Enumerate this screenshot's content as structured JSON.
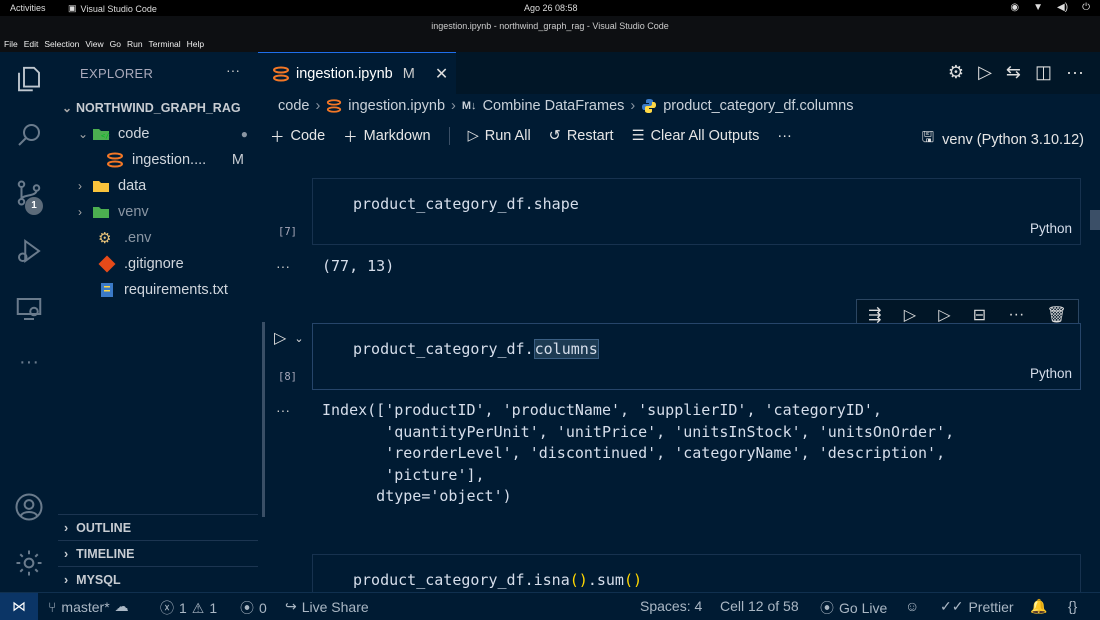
{
  "gnome": {
    "activities": "Activities",
    "app": "Visual Studio Code",
    "clock": "Ago 26  08:58"
  },
  "window": {
    "title": "ingestion.ipynb - northwind_graph_rag - Visual Studio Code"
  },
  "menu": [
    "File",
    "Edit",
    "Selection",
    "View",
    "Go",
    "Run",
    "Terminal",
    "Help"
  ],
  "activity_bar": {
    "icons": [
      "files-icon",
      "search-icon",
      "source-control-icon",
      "run-debug-icon",
      "remote-explorer-icon",
      "more-icon",
      "account-icon",
      "settings-gear-icon"
    ],
    "scm_badge": "1"
  },
  "sidebar": {
    "title": "EXPLORER",
    "more": "···",
    "root": "NORTHWIND_GRAPH_RAG",
    "tree": [
      {
        "label": "code",
        "badge": "●"
      },
      {
        "label": "ingestion....",
        "badge": "M"
      },
      {
        "label": "data"
      },
      {
        "label": "venv"
      },
      {
        "label": ".env"
      },
      {
        "label": ".gitignore"
      },
      {
        "label": "requirements.txt"
      }
    ],
    "sections": [
      "OUTLINE",
      "TIMELINE",
      "MYSQL"
    ]
  },
  "tab": {
    "name": "ingestion.ipynb",
    "modified": "M",
    "close": "✕"
  },
  "breadcrumb": {
    "folder": "code",
    "file": "ingestion.ipynb",
    "section_prefix": "M↓",
    "section": "Combine DataFrames",
    "symbol": "product_category_df.columns"
  },
  "toolbar": {
    "code": "Code",
    "markdown": "Markdown",
    "run_all": "Run All",
    "restart": "Restart",
    "clear": "Clear All Outputs",
    "more": "···",
    "kernel": "venv (Python 3.10.12)"
  },
  "cells": [
    {
      "num": "[7]",
      "code": "product_category_df.shape",
      "lang": "Python",
      "output": "(77, 13)"
    },
    {
      "num": "[8]",
      "code_prefix": "product_category_df.",
      "code_selected": "columns",
      "lang": "Python",
      "output": "Index(['productID', 'productName', 'supplierID', 'categoryID',\n       'quantityPerUnit', 'unitPrice', 'unitsInStock', 'unitsOnOrder',\n       'reorderLevel', 'discontinued', 'categoryName', 'description',\n       'picture'],\n      dtype='object')"
    },
    {
      "code_p1": "product_category_df.isna",
      "code_p2": "()",
      "code_p3": ".sum",
      "code_p4": "()"
    }
  ],
  "output_more": "···",
  "status": {
    "branch": "master*",
    "errors": "1",
    "warnings": "1",
    "ports": "0",
    "live_share": "Live Share",
    "spaces": "Spaces: 4",
    "cell": "Cell 12 of 58",
    "go_live": "Go Live",
    "prettier": "Prettier",
    "braces": "{}"
  }
}
